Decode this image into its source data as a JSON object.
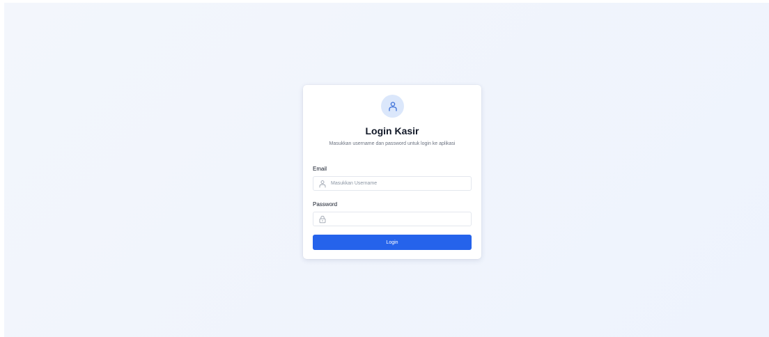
{
  "login": {
    "title": "Login Kasir",
    "subtitle": "Masukkan username dan password untuk login ke aplikasi",
    "email_label": "Email",
    "email_placeholder": "Masukkan Username",
    "password_label": "Password",
    "password_placeholder": "",
    "login_button": "Login"
  },
  "icons": {
    "avatar": "user-icon",
    "email_field": "user-icon",
    "password_field": "lock-icon"
  },
  "colors": {
    "primary": "#2563eb",
    "avatar_bg": "#dbe7fb",
    "background": "#eef3fd"
  }
}
